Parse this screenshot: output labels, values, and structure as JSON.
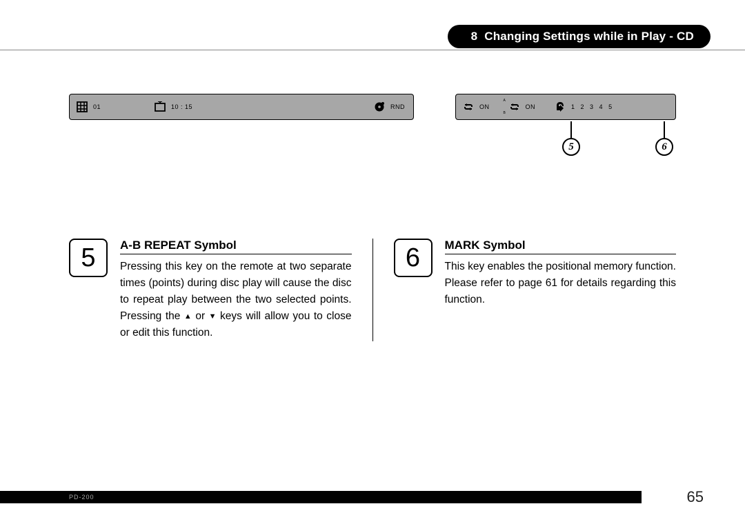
{
  "header": {
    "section_number": "8",
    "title": "Changing Settings while in Play - CD"
  },
  "panel_left": {
    "track": "01",
    "time": "10 : 15",
    "mode": "RND"
  },
  "panel_right": {
    "repeat": "ON",
    "ab_letters_top": "A",
    "ab_letters_bottom": "B",
    "ab_on": "ON",
    "marks": [
      "1",
      "2",
      "3",
      "4",
      "5"
    ]
  },
  "callouts": {
    "c5": "5",
    "c6": "6"
  },
  "sections": {
    "s5": {
      "num": "5",
      "title": "A-B REPEAT Symbol",
      "text_before_arrows": "Pressing this key on the remote at two separate times (points) during disc play will cause the disc to repeat play between the two selected points. Pressing the ",
      "text_between_arrows": " or ",
      "text_after_arrows": " keys will allow you to close or edit this function."
    },
    "s6": {
      "num": "6",
      "title": "MARK Symbol",
      "text": "This key enables the positional memory function. Please refer to page 61 for details regarding this function."
    }
  },
  "footer": {
    "model": "PD-200",
    "page": "65"
  }
}
